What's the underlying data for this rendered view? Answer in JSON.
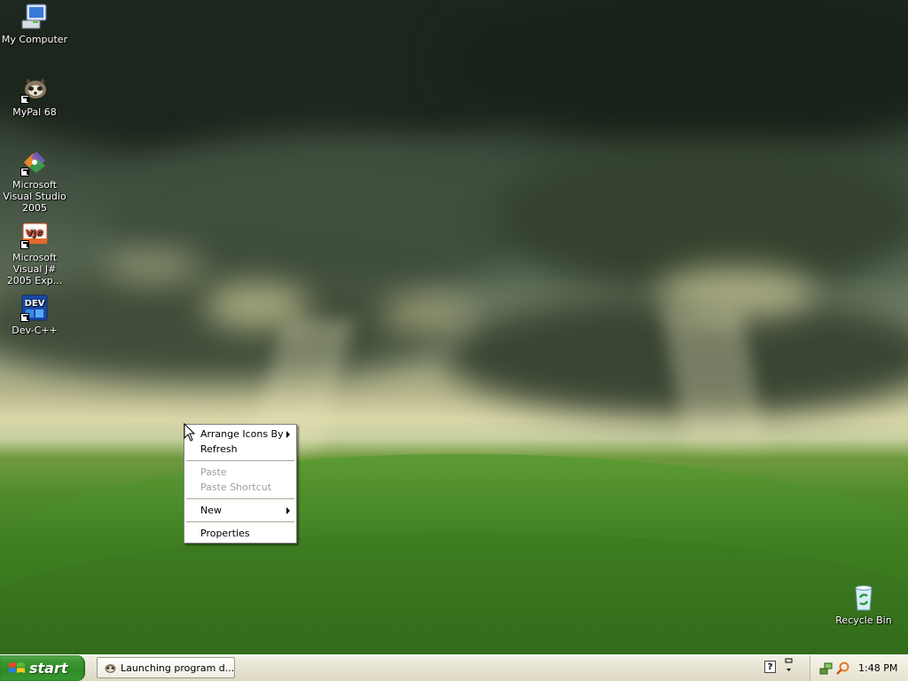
{
  "desktop": {
    "icons": [
      {
        "label": "My Computer",
        "icon": "my-computer-icon"
      },
      {
        "label": "MyPal 68",
        "icon": "mypal-icon"
      },
      {
        "label": "Microsoft Visual Studio 2005",
        "icon": "visual-studio-icon"
      },
      {
        "label": "Microsoft Visual J# 2005 Exp...",
        "icon": "visual-jsharp-icon",
        "badge": "VJ#"
      },
      {
        "label": "Dev-C++",
        "icon": "dev-cpp-icon",
        "badge": "DEV"
      },
      {
        "label": "Recycle Bin",
        "icon": "recycle-bin-icon"
      }
    ]
  },
  "context_menu": {
    "items": [
      {
        "label": "Arrange Icons By",
        "enabled": true,
        "submenu": true
      },
      {
        "label": "Refresh",
        "enabled": true,
        "submenu": false
      },
      {
        "label": "Paste",
        "enabled": false,
        "submenu": false
      },
      {
        "label": "Paste Shortcut",
        "enabled": false,
        "submenu": false
      },
      {
        "label": "New",
        "enabled": true,
        "submenu": true
      },
      {
        "label": "Properties",
        "enabled": true,
        "submenu": false
      }
    ]
  },
  "taskbar": {
    "start_label": "start",
    "task_button_label": "Launching program d...",
    "help_glyph": "?",
    "clock": "1:48 PM"
  },
  "colors": {
    "start_green": "#3c9a34",
    "taskbar_bg": "#ebe8d8",
    "menu_disabled": "#a0a0a0"
  }
}
